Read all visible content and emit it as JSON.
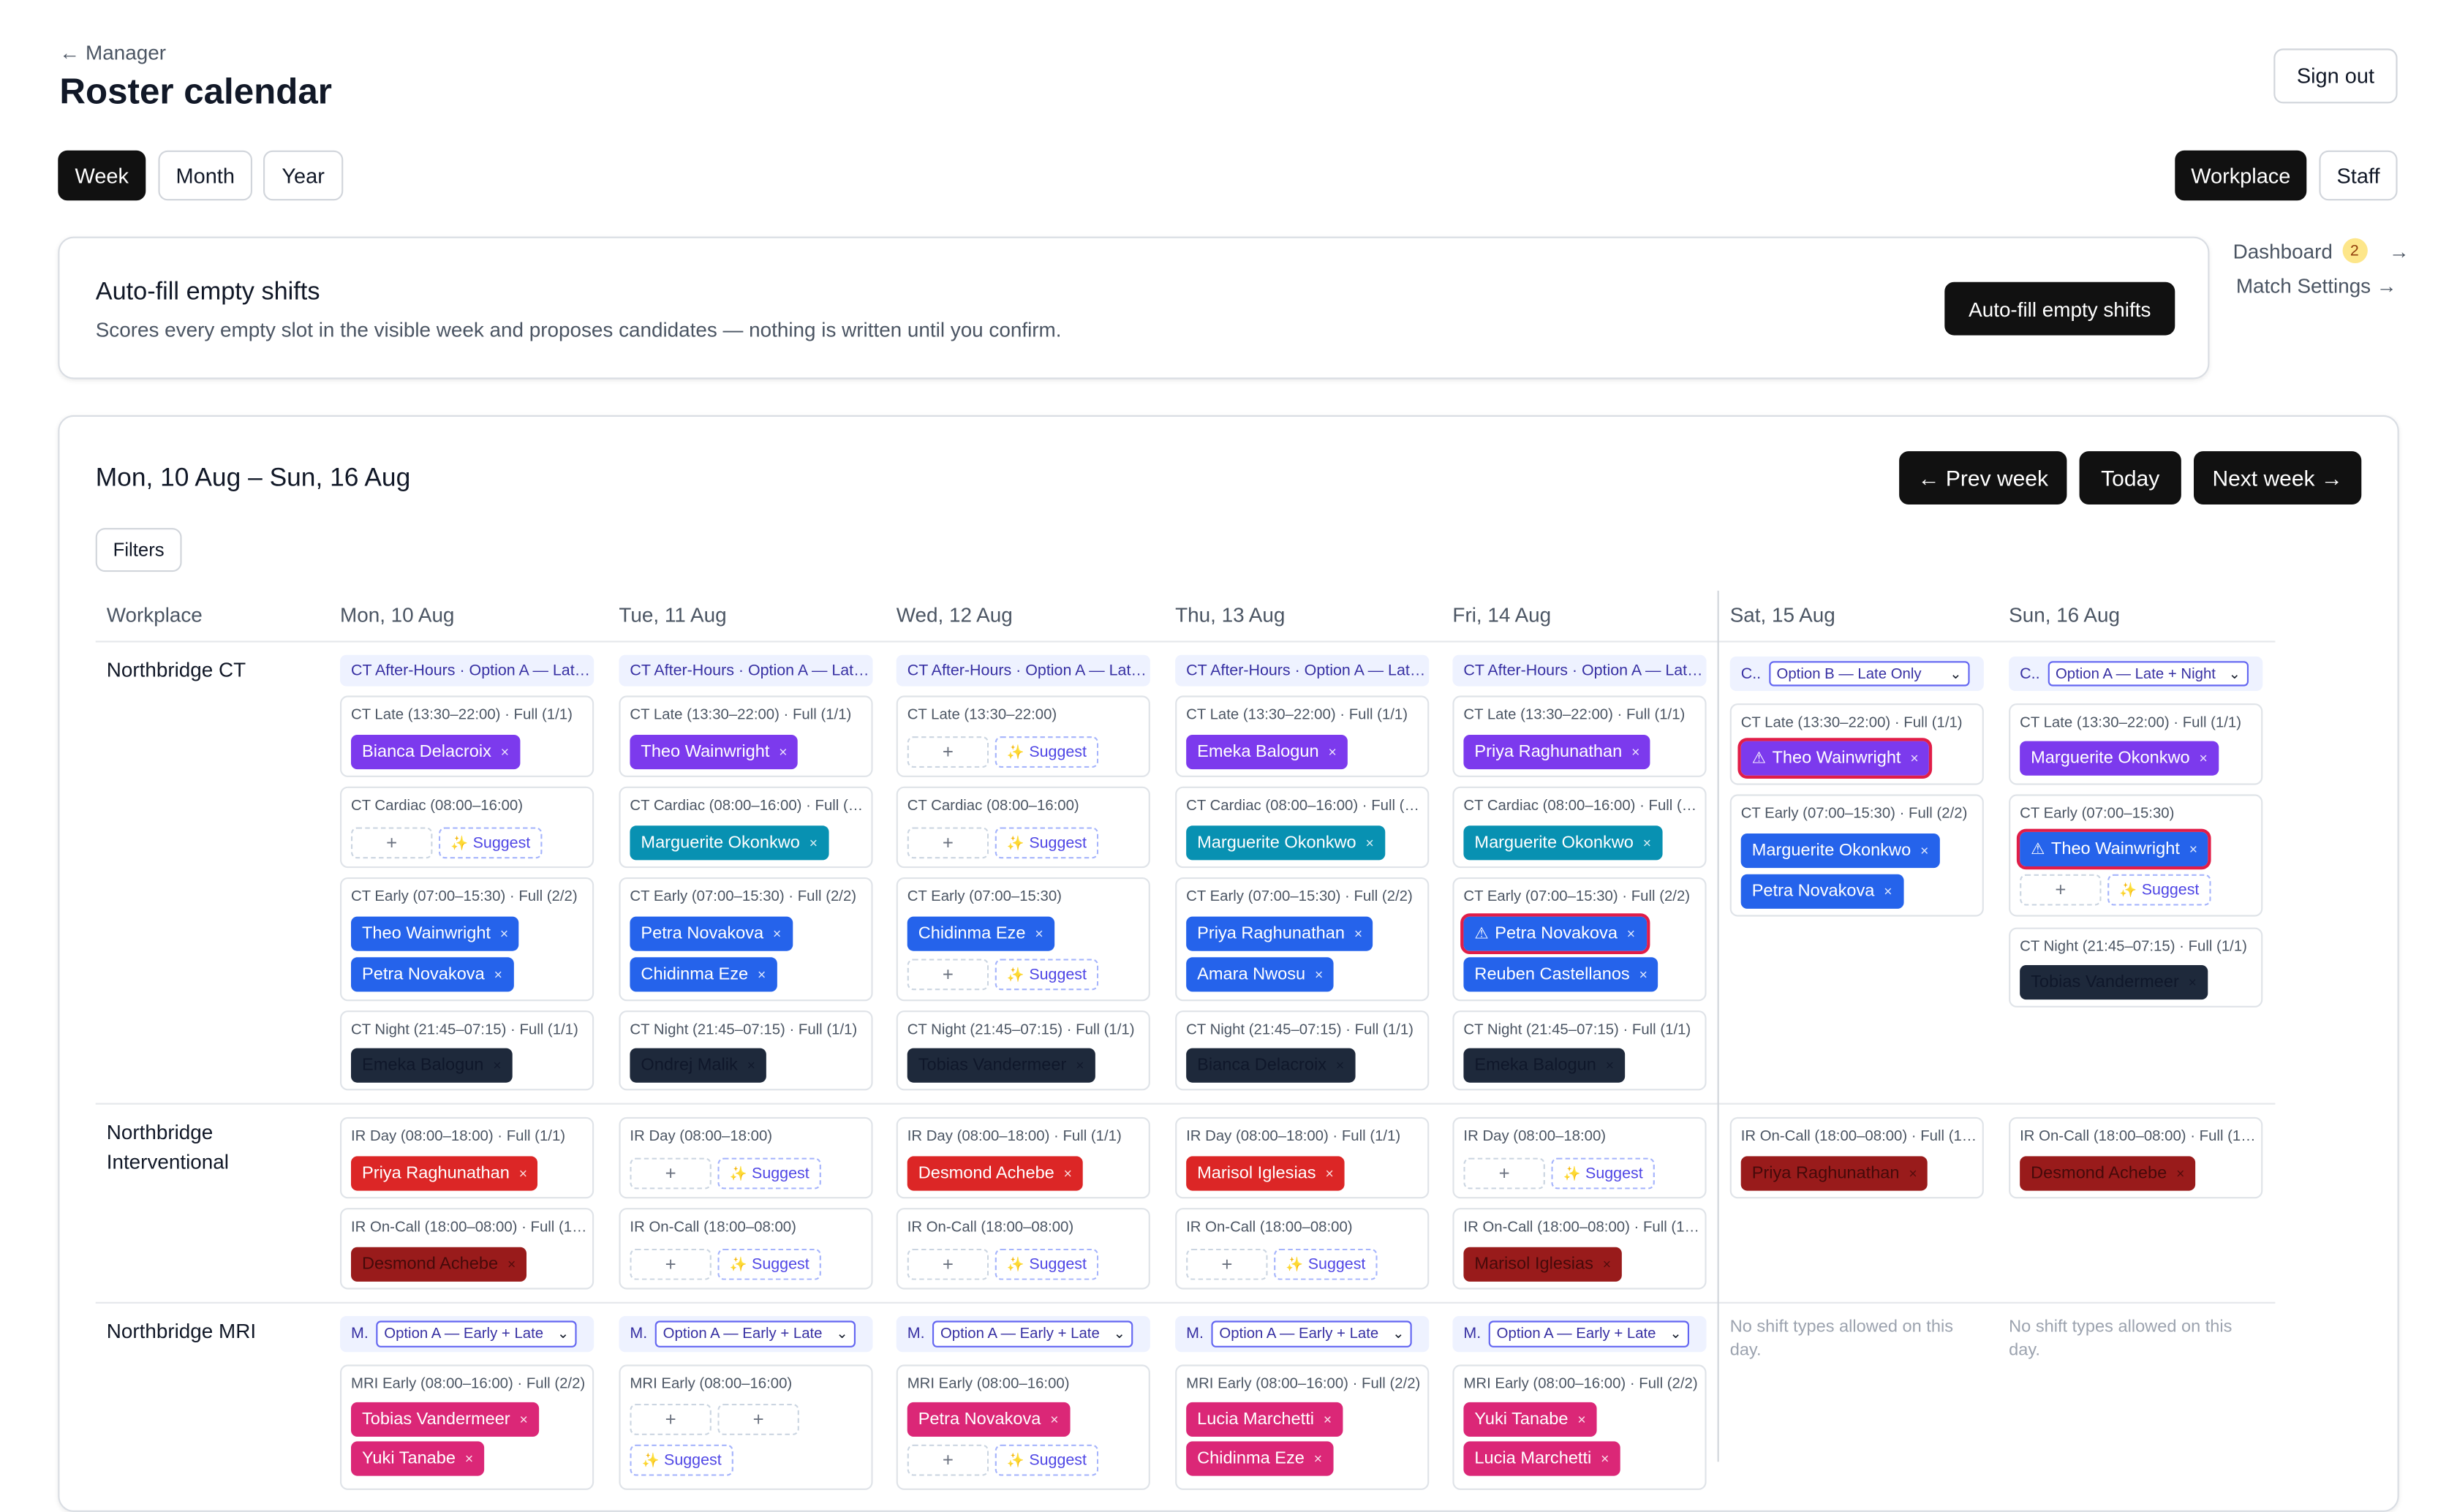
{
  "header": {
    "back_label": "← Manager",
    "title": "Roster calendar",
    "sign_out": "Sign out"
  },
  "view_tabs": [
    {
      "label": "Week",
      "active": true
    },
    {
      "label": "Month",
      "active": false
    },
    {
      "label": "Year",
      "active": false
    }
  ],
  "mode_tabs": [
    {
      "label": "Workplace",
      "active": true
    },
    {
      "label": "Staff",
      "active": false
    }
  ],
  "autofill": {
    "title": "Auto-fill empty shifts",
    "description": "Scores every empty slot in the visible week and proposes candidates — nothing is written until you confirm.",
    "button": "Auto-fill empty shifts"
  },
  "side_links": {
    "dashboard": "Dashboard",
    "dashboard_badge": "2",
    "arrow": "→",
    "match_settings": "Match Settings →"
  },
  "calendar": {
    "range": "Mon, 10 Aug – Sun, 16 Aug",
    "prev": "← Prev week",
    "today": "Today",
    "next": "Next week →",
    "filters": "Filters",
    "workplace_header": "Workplace",
    "days": [
      "Mon, 10 Aug",
      "Tue, 11 Aug",
      "Wed, 12 Aug",
      "Thu, 13 Aug",
      "Fri, 14 Aug",
      "Sat, 15 Aug",
      "Sun, 16 Aug"
    ],
    "rows": [
      "Northbridge CT",
      "Northbridge Interventional",
      "Northbridge MRI"
    ],
    "add_symbol": "+",
    "suggest_label": "Suggest",
    "remove_symbol": "×",
    "warn_symbol": "⚠",
    "option_ct_weekday": "CT After-Hours · Option A — Lat…",
    "option_ct_sat_prefix": "C..",
    "option_ct_sat_select": "Option B — Late Only",
    "option_ct_sun_prefix": "C..",
    "option_ct_sun_select": "Option A — Late + Night",
    "option_mri_prefix": "M.",
    "option_mri_select": "Option A — Early + Late",
    "no_shift_text": "No shift types allowed on this day.",
    "shifts": {
      "ct_late_full": "CT Late (13:30–22:00) · Full (1/1)",
      "ct_late": "CT Late (13:30–22:00)",
      "ct_cardiac": "CT Cardiac (08:00–16:00)",
      "ct_cardiac_full": "CT Cardiac (08:00–16:00) · Full (…",
      "ct_early_full": "CT Early (07:00–15:30) · Full (2/2)",
      "ct_early": "CT Early (07:00–15:30)",
      "ct_night_full": "CT Night (21:45–07:15) · Full (1/1)",
      "ir_day_full": "IR Day (08:00–18:00) · Full (1/1)",
      "ir_day": "IR Day (08:00–18:00)",
      "ir_oncall_full": "IR On-Call (18:00–08:00) · Full (1…",
      "ir_oncall": "IR On-Call (18:00–08:00)",
      "mri_early_full": "MRI Early (08:00–16:00) · Full (2/2)",
      "mri_early": "MRI Early (08:00–16:00)"
    }
  },
  "staff": {
    "bianca": "Bianca Delacroix",
    "theo": "Theo Wainwright",
    "emeka": "Emeka Balogun",
    "priya": "Priya Raghunathan",
    "marguerite": "Marguerite Okonkwo",
    "petra": "Petra Novakova",
    "chidinma": "Chidinma Eze",
    "amara": "Amara Nwosu",
    "reuben": "Reuben Castellanos",
    "ondrej": "Ondrej Malik",
    "tobias": "Tobias Vandermeer",
    "desmond": "Desmond Achebe",
    "marisol": "Marisol Iglesias",
    "lucia": "Lucia Marchetti",
    "yuki": "Yuki Tanabe"
  },
  "colors": {
    "primary": "#111111",
    "ct_late": "#7c3aed",
    "ct_early": "#2563eb",
    "ct_cardiac": "#0891b2",
    "ct_night": "#1e293b",
    "ir_day": "#dc2626",
    "ir_oncall": "#991b1b",
    "mri": "#db2777",
    "warning": "#e11d48"
  }
}
